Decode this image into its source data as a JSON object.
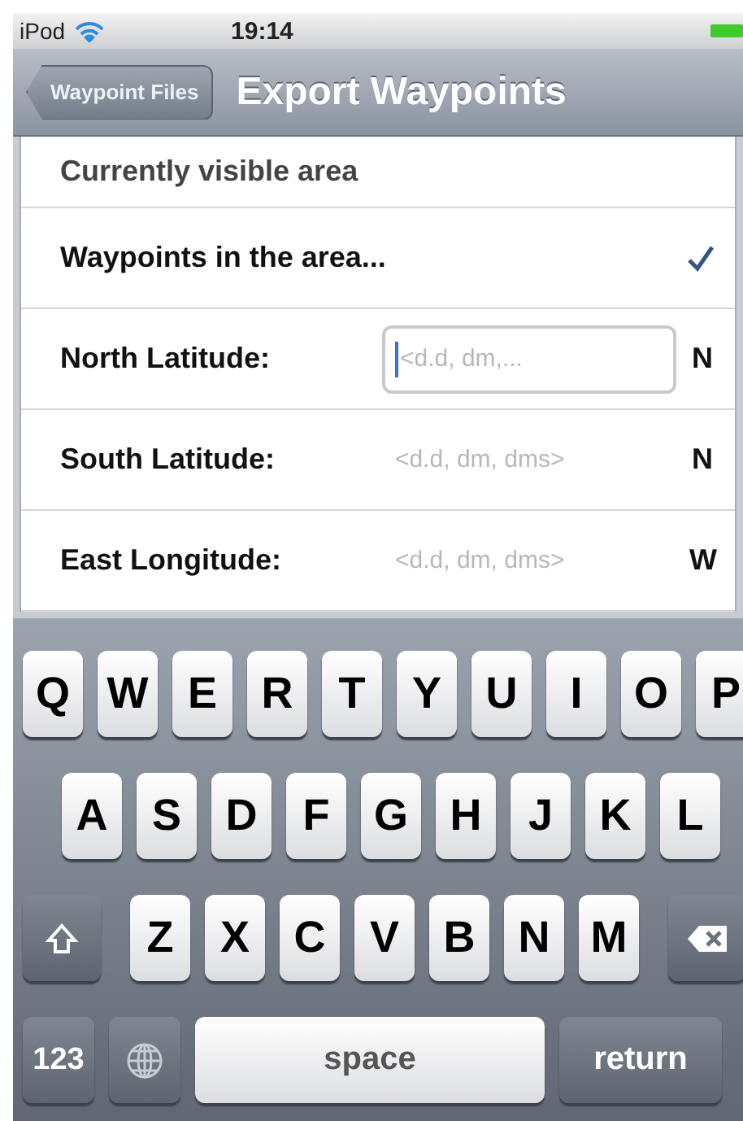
{
  "status_bar": {
    "carrier": "iPod",
    "time": "19:14"
  },
  "nav_bar": {
    "back_button": "Waypoint Files",
    "title": "Export Waypoints"
  },
  "options": [
    {
      "label": "Currently visible area",
      "checked": false
    },
    {
      "label": "Waypoints in the area...",
      "checked": true
    }
  ],
  "coordinates": [
    {
      "label": "North Latitude:",
      "placeholder": "<d.d, dm,...",
      "hemisphere": "N",
      "focused": true
    },
    {
      "label": "South Latitude:",
      "placeholder": "<d.d, dm, dms>",
      "hemisphere": "N",
      "focused": false
    },
    {
      "label": "East Longitude:",
      "placeholder": "<d.d, dm, dms>",
      "hemisphere": "W",
      "focused": false
    }
  ],
  "keyboard": {
    "rows": [
      [
        "Q",
        "W",
        "E",
        "R",
        "T",
        "Y",
        "U",
        "I",
        "O",
        "P"
      ],
      [
        "A",
        "S",
        "D",
        "F",
        "G",
        "H",
        "J",
        "K",
        "L"
      ],
      [
        "Z",
        "X",
        "C",
        "V",
        "B",
        "N",
        "M"
      ]
    ],
    "number_key": "123",
    "space_key": "space",
    "return_key": "return"
  }
}
